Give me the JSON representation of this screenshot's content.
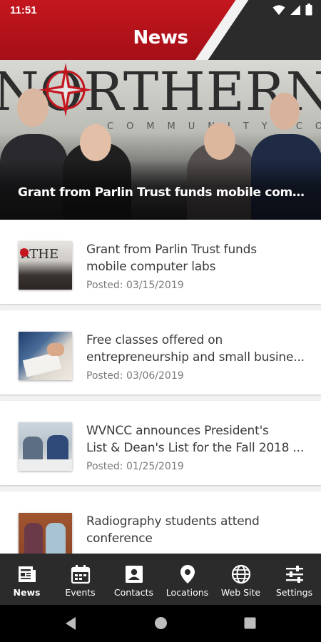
{
  "status_bar": {
    "time": "11:51",
    "icons": [
      "wifi-icon",
      "signal-icon",
      "battery-icon"
    ]
  },
  "header": {
    "title": "News"
  },
  "hero": {
    "caption": "Grant from Parlin Trust funds mobile compute...",
    "backdrop_word": "NORTHERN",
    "backdrop_sub": "COMMUNITY COLLEGE"
  },
  "articles": [
    {
      "title_line1": "Grant from Parlin Trust funds",
      "title_line2": "mobile computer labs",
      "date": "Posted: 03/15/2019",
      "thumb": "group-photo"
    },
    {
      "title_line1": "Free classes offered on",
      "title_line2": "entrepreneurship and small busine...",
      "date": "Posted: 03/06/2019",
      "thumb": "writing-photo"
    },
    {
      "title_line1": "WVNCC announces President's",
      "title_line2": "List & Dean's List for the Fall 2018 ...",
      "date": "Posted: 01/25/2019",
      "thumb": "students-photo"
    },
    {
      "title_line1": "Radiography students attend",
      "title_line2": "conference",
      "date": "",
      "thumb": "two-students-photo"
    }
  ],
  "bottom_nav": [
    {
      "label": "News",
      "icon": "newspaper-icon",
      "active": true
    },
    {
      "label": "Events",
      "icon": "calendar-icon",
      "active": false
    },
    {
      "label": "Contacts",
      "icon": "contact-card-icon",
      "active": false
    },
    {
      "label": "Locations",
      "icon": "map-pin-icon",
      "active": false
    },
    {
      "label": "Web Site",
      "icon": "globe-icon",
      "active": false
    },
    {
      "label": "Settings",
      "icon": "sliders-icon",
      "active": false
    }
  ],
  "colors": {
    "brand_red": "#b5121b",
    "dark": "#2b2b2b",
    "text": "#3a3a3a",
    "muted": "#7a7a7a"
  }
}
